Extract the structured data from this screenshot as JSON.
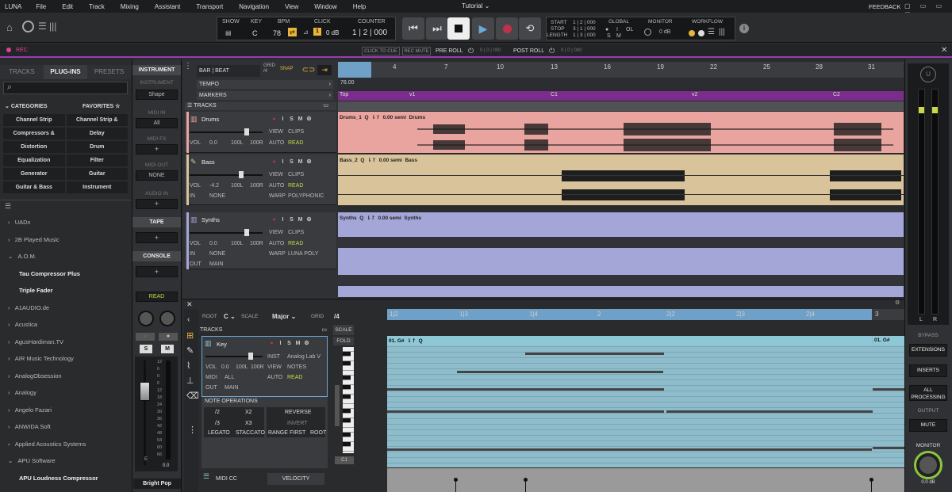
{
  "menu": [
    "LUNA",
    "File",
    "Edit",
    "Track",
    "Mixing",
    "Assistant",
    "Transport",
    "Navigation",
    "View",
    "Window",
    "Help"
  ],
  "title": "Tutorial",
  "feedback": "FEEDBACK",
  "toolbar": {
    "show": "SHOW",
    "key": "KEY",
    "bpm": "BPM",
    "click": "CLICK",
    "counter": "COUNTER",
    "key_val": "C",
    "bpm_val": "78",
    "click_db": "0 dB",
    "click_num": "1",
    "counter_val": "1 | 2 | 000",
    "start": "START",
    "stop": "STOP",
    "length": "LENGTH",
    "start_val": "1 | 2 | 000",
    "stop_val": "3 | 1 | 000",
    "length_val": "1 | 3 | 000",
    "global": "GLOBAL",
    "monitor": "MONITOR",
    "workflow": "WORKFLOW",
    "i": "I",
    "ol": "OL",
    "s": "S",
    "m": "M",
    "mon_db": "0 dB"
  },
  "recbar": {
    "rec": "REC",
    "click_to_cue": "CLICK TO CUE",
    "rec_mute": "REC MUTE",
    "pre_roll": "PRE ROLL",
    "pre_val": "0 | 0 | 000",
    "post_roll": "POST ROLL",
    "post_val": "0 | 0 | 000"
  },
  "browser": {
    "tabs": [
      "TRACKS",
      "PLUG-INS",
      "PRESETS"
    ],
    "categories": "CATEGORIES",
    "favorites": "FAVORITES",
    "cats": [
      "Channel Strip",
      "Channel Strip & Preamp",
      "Compressors & Limiters",
      "Delay",
      "Distortion",
      "Drum",
      "Equalization",
      "Filter",
      "Generator",
      "Guitar",
      "Guitar & Bass",
      "Instrument"
    ],
    "vendors": [
      "UADx",
      "2B Played Music",
      "A.O.M.",
      "Tau Compressor Plus",
      "Triple Fader",
      "A1AUDIO.de",
      "Acustica",
      "AgusHardiman.TV",
      "AIR Music Technology",
      "AnalogObsession",
      "Analogy",
      "Angelo Fazari",
      "ANWIDA Soft",
      "Applied Acoustics Systems",
      "APU Software",
      "APU Loudness Compressor"
    ]
  },
  "inspector": {
    "instrument": "INSTRUMENT",
    "instrument2": "INSTRUMENT",
    "shape": "Shape",
    "midi_in": "MIDI IN",
    "all": "All",
    "midi_fx": "MIDI FX",
    "midi_out": "MIDI OUT",
    "none": "NONE",
    "audio_in": "AUDIO IN",
    "tape": "TAPE",
    "console": "CONSOLE",
    "read": "READ",
    "preset": "Bright Pop",
    "fader_db": "0.0",
    "scale": [
      "12",
      "6",
      "0",
      "6",
      "12",
      "18",
      "24",
      "30",
      "36",
      "42",
      "48",
      "54",
      "60",
      "66"
    ],
    "e_label": "E"
  },
  "arrange": {
    "bar_beat": "BAR | BEAT",
    "grid": "GRID",
    "grid_val": "/4",
    "snap": "SNAP",
    "tempo": "TEMPO",
    "markers": "MARKERS",
    "tracks": "TRACKS",
    "tempo_val": "78.00",
    "ruler": [
      "4",
      "7",
      "10",
      "13",
      "16",
      "19",
      "22",
      "25",
      "28",
      "31"
    ],
    "marker_names": [
      "Top",
      "v1",
      "C1",
      "v2",
      "C2"
    ]
  },
  "tracks": [
    {
      "name": "Drums",
      "vol": "0.0",
      "pan_l": "100L",
      "pan_r": "100R",
      "view": "VIEW",
      "view_val": "CLIPS",
      "auto": "AUTO",
      "auto_val": "READ",
      "clip": "Drums_1",
      "semi": "0.00 semi",
      "clipname": "Drums"
    },
    {
      "name": "Bass",
      "vol": "-4.2",
      "pan_l": "100L",
      "pan_r": "100R",
      "view": "VIEW",
      "view_val": "CLIPS",
      "auto": "AUTO",
      "auto_val": "READ",
      "in": "IN",
      "in_val": "NONE",
      "warp": "WARP",
      "warp_val": "POLYPHONIC",
      "clip": "Bass_2",
      "semi": "0.00 semi",
      "clipname": "Bass"
    },
    {
      "name": "Synths",
      "vol": "0.0",
      "pan_l": "100L",
      "pan_r": "100R",
      "view": "VIEW",
      "view_val": "CLIPS",
      "auto": "AUTO",
      "auto_val": "READ",
      "in": "IN",
      "in_val": "NONE",
      "out": "OUT",
      "out_val": "MAIN",
      "warp": "WARP",
      "warp_val": "LUNA POLY",
      "clip": "Synths",
      "semi": "0.00 semi",
      "clipname": "Synths"
    }
  ],
  "editor": {
    "root": "ROOT",
    "root_val": "C",
    "scale": "SCALE",
    "scale_val": "Major",
    "grid": "GRID",
    "grid_val": "/4",
    "tracks": "TRACKS",
    "scale2": "SCALE",
    "fold": "FOLD",
    "ruler": [
      "1|2",
      "1|3",
      "1|4",
      "2",
      "2|2",
      "2|3",
      "2|4",
      "3"
    ],
    "track": "Key",
    "inst": "INST",
    "inst_val": "Analog Lab V",
    "vol": "VOL",
    "vol_val": "0.0",
    "pl": "100L",
    "pr": "100R",
    "view": "VIEW",
    "view_val": "NOTES",
    "midi": "MIDI",
    "midi_val": "ALL",
    "auto": "AUTO",
    "auto_val": "READ",
    "out": "OUT",
    "out_val": "MAIN",
    "noteops": "NOTE OPERATIONS",
    "ops": [
      "/2",
      "X2",
      "REVERSE",
      "/3",
      "X3",
      "INVERT",
      "LEGATO",
      "STACCATO",
      "RANGE",
      "FIRST",
      "ROOT"
    ],
    "midi_cc": "MIDI CC",
    "velocity": "VELOCITY",
    "clip": "01. G#",
    "clip2": "01. G#",
    "c1": "C1"
  },
  "right": {
    "bypass": "BYPASS",
    "extensions": "EXTENSIONS",
    "inserts": "INSERTS",
    "all_processing": "ALL PROCESSING",
    "output": "OUTPUT",
    "mute": "MUTE",
    "monitor": "MONITOR",
    "mon_db": "0.0 dB",
    "l": "L",
    "r": "R"
  },
  "colors": {
    "accent": "#9c3ab6",
    "drums": "#e9a49f",
    "bass": "#d8c39a",
    "synths": "#a5a6d8",
    "midi": "#8ec7d6",
    "read": "#c8d84a"
  }
}
